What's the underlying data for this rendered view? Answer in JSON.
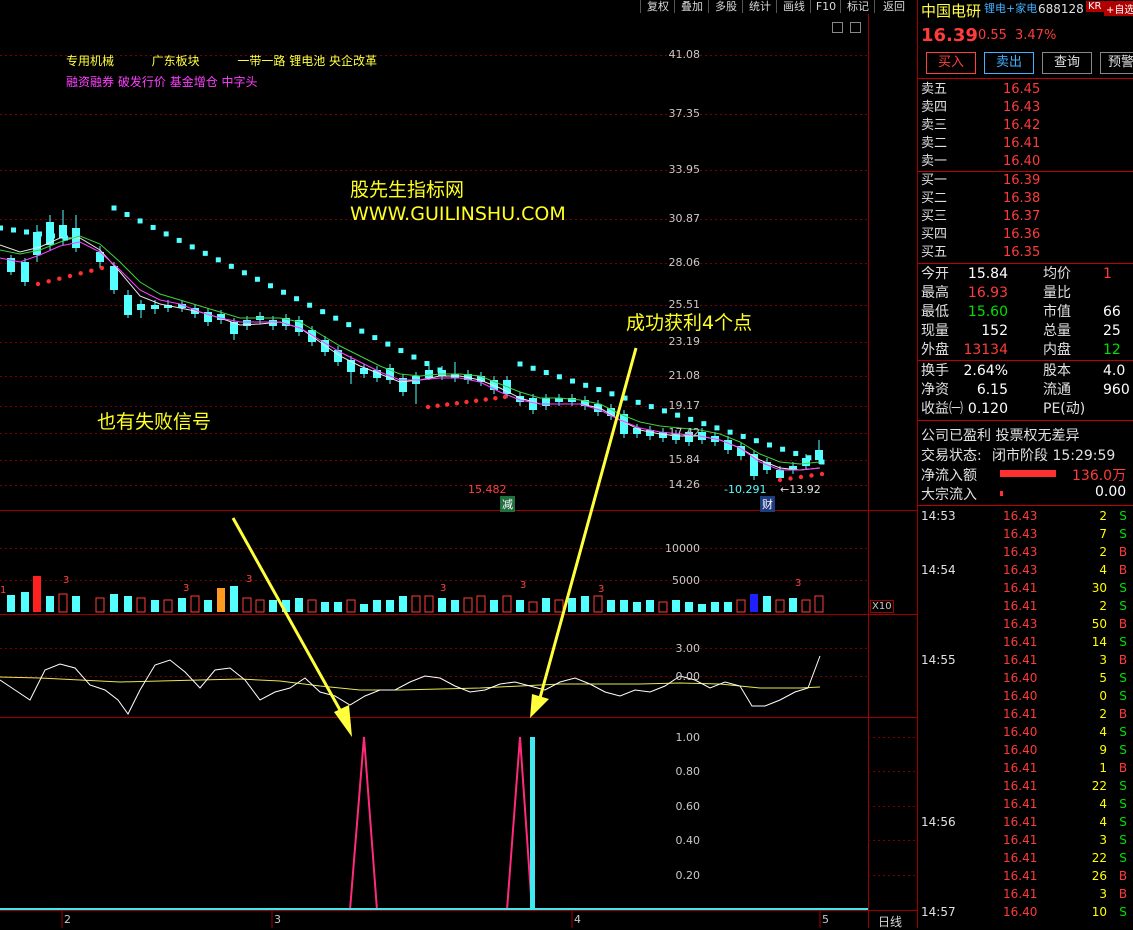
{
  "toolbar": {
    "buttons": [
      "复权",
      "叠加",
      "多股",
      "统计",
      "画线",
      "F10",
      "标记",
      "返回"
    ]
  },
  "stock": {
    "name": "中国电研",
    "concept": "锂电+家电",
    "code": "688128",
    "badge": "KR",
    "fav": "+自选",
    "price": "16.39",
    "change": "0.55",
    "pct": "3.47%"
  },
  "trade_buttons": [
    "买入",
    "卖出",
    "查询",
    "预警"
  ],
  "tags": {
    "line1": [
      "专用机械",
      "广东板块",
      "一带一路",
      "锂电池",
      "央企改革"
    ],
    "line2": [
      "融资融券",
      "破发行价",
      "基金增仓",
      "中字头"
    ]
  },
  "annotations": {
    "watermark1": "股先生指标网",
    "watermark2": "WWW.GUILINSHU.COM",
    "fail": "也有失败信号",
    "success": "成功获利4个点",
    "high_label": "15.482",
    "low_label": "-10.291",
    "low_price": "←13.92",
    "event1": "减",
    "event2": "财"
  },
  "price_axis": [
    "41.08",
    "37.35",
    "33.95",
    "30.87",
    "28.06",
    "25.51",
    "23.19",
    "21.08",
    "19.17",
    "17.42",
    "15.84",
    "14.26"
  ],
  "volume_axis": [
    "10000",
    "5000"
  ],
  "volume_unit": "X10",
  "osc_axis": [
    "3.00",
    "0.00"
  ],
  "signal_axis": [
    "1.00",
    "0.80",
    "0.60",
    "0.40",
    "0.20"
  ],
  "x_axis": [
    "2",
    "3",
    "4",
    "5"
  ],
  "period": "日线",
  "volume_markers": [
    "3",
    "3",
    "3",
    "3",
    "3",
    "3",
    "3",
    "1"
  ],
  "orderbook": {
    "sells": [
      {
        "label": "卖五",
        "price": "16.45"
      },
      {
        "label": "卖四",
        "price": "16.43"
      },
      {
        "label": "卖三",
        "price": "16.42"
      },
      {
        "label": "卖二",
        "price": "16.41"
      },
      {
        "label": "卖一",
        "price": "16.40"
      }
    ],
    "buys": [
      {
        "label": "买一",
        "price": "16.39"
      },
      {
        "label": "买二",
        "price": "16.38"
      },
      {
        "label": "买三",
        "price": "16.37"
      },
      {
        "label": "买四",
        "price": "16.36"
      },
      {
        "label": "买五",
        "price": "16.35"
      }
    ]
  },
  "stats": [
    {
      "k1": "今开",
      "v1": "15.84",
      "c1": "#ffffff",
      "k2": "均价",
      "v2": "1"
    },
    {
      "k1": "最高",
      "v1": "16.93",
      "c1": "#ff3b3b",
      "k2": "量比",
      "v2": ""
    },
    {
      "k1": "最低",
      "v1": "15.60",
      "c1": "#00e000",
      "k2": "市值",
      "v2": "66"
    },
    {
      "k1": "现量",
      "v1": "152",
      "c1": "#ffffff",
      "k2": "总量",
      "v2": "25"
    },
    {
      "k1": "外盘",
      "v1": "13134",
      "c1": "#ff3b3b",
      "k2": "内盘",
      "v2": "12"
    }
  ],
  "stats2": [
    {
      "k1": "换手",
      "v1": "2.64%",
      "c1": "#ffffff",
      "k2": "股本",
      "v2": "4.0"
    },
    {
      "k1": "净资",
      "v1": "6.15",
      "c1": "#ffffff",
      "k2": "流通",
      "v2": "960"
    },
    {
      "k1": "收益㈠",
      "v1": "0.120",
      "c1": "#ffffff",
      "k2": "PE(动)",
      "v2": ""
    }
  ],
  "status": {
    "line1": "公司已盈利 投票权无差异",
    "line2_k": "交易状态:",
    "line2_v": "闭市阶段 15:29:59",
    "netflow_k": "净流入额",
    "netflow_v": "136.0万",
    "block_k": "大宗流入",
    "block_v": "0.00"
  },
  "ticks": [
    {
      "t": "14:53",
      "p": "16.43",
      "v": "2",
      "bs": "S"
    },
    {
      "t": "",
      "p": "16.43",
      "v": "7",
      "bs": "S"
    },
    {
      "t": "",
      "p": "16.43",
      "v": "2",
      "bs": "B"
    },
    {
      "t": "14:54",
      "p": "16.43",
      "v": "4",
      "bs": "B"
    },
    {
      "t": "",
      "p": "16.41",
      "v": "30",
      "bs": "S"
    },
    {
      "t": "",
      "p": "16.41",
      "v": "2",
      "bs": "S"
    },
    {
      "t": "",
      "p": "16.43",
      "v": "50",
      "bs": "B"
    },
    {
      "t": "",
      "p": "16.41",
      "v": "14",
      "bs": "S"
    },
    {
      "t": "14:55",
      "p": "16.41",
      "v": "3",
      "bs": "B"
    },
    {
      "t": "",
      "p": "16.40",
      "v": "5",
      "bs": "S"
    },
    {
      "t": "",
      "p": "16.40",
      "v": "0",
      "bs": "S"
    },
    {
      "t": "",
      "p": "16.41",
      "v": "2",
      "bs": "B"
    },
    {
      "t": "",
      "p": "16.40",
      "v": "4",
      "bs": "S"
    },
    {
      "t": "",
      "p": "16.40",
      "v": "9",
      "bs": "S"
    },
    {
      "t": "",
      "p": "16.41",
      "v": "1",
      "bs": "B"
    },
    {
      "t": "",
      "p": "16.41",
      "v": "22",
      "bs": "S"
    },
    {
      "t": "",
      "p": "16.41",
      "v": "4",
      "bs": "S"
    },
    {
      "t": "14:56",
      "p": "16.41",
      "v": "4",
      "bs": "S"
    },
    {
      "t": "",
      "p": "16.41",
      "v": "3",
      "bs": "S"
    },
    {
      "t": "",
      "p": "16.41",
      "v": "22",
      "bs": "S"
    },
    {
      "t": "",
      "p": "16.41",
      "v": "26",
      "bs": "B"
    },
    {
      "t": "",
      "p": "16.41",
      "v": "3",
      "bs": "B"
    },
    {
      "t": "14:57",
      "p": "16.40",
      "v": "10",
      "bs": "S"
    }
  ],
  "colors": {
    "up": "#ff3b3b",
    "down": "#54ffff",
    "signal_fail": "#ff2b7a",
    "signal_win": "#40e8f0",
    "arrow": "#ffff3c"
  }
}
